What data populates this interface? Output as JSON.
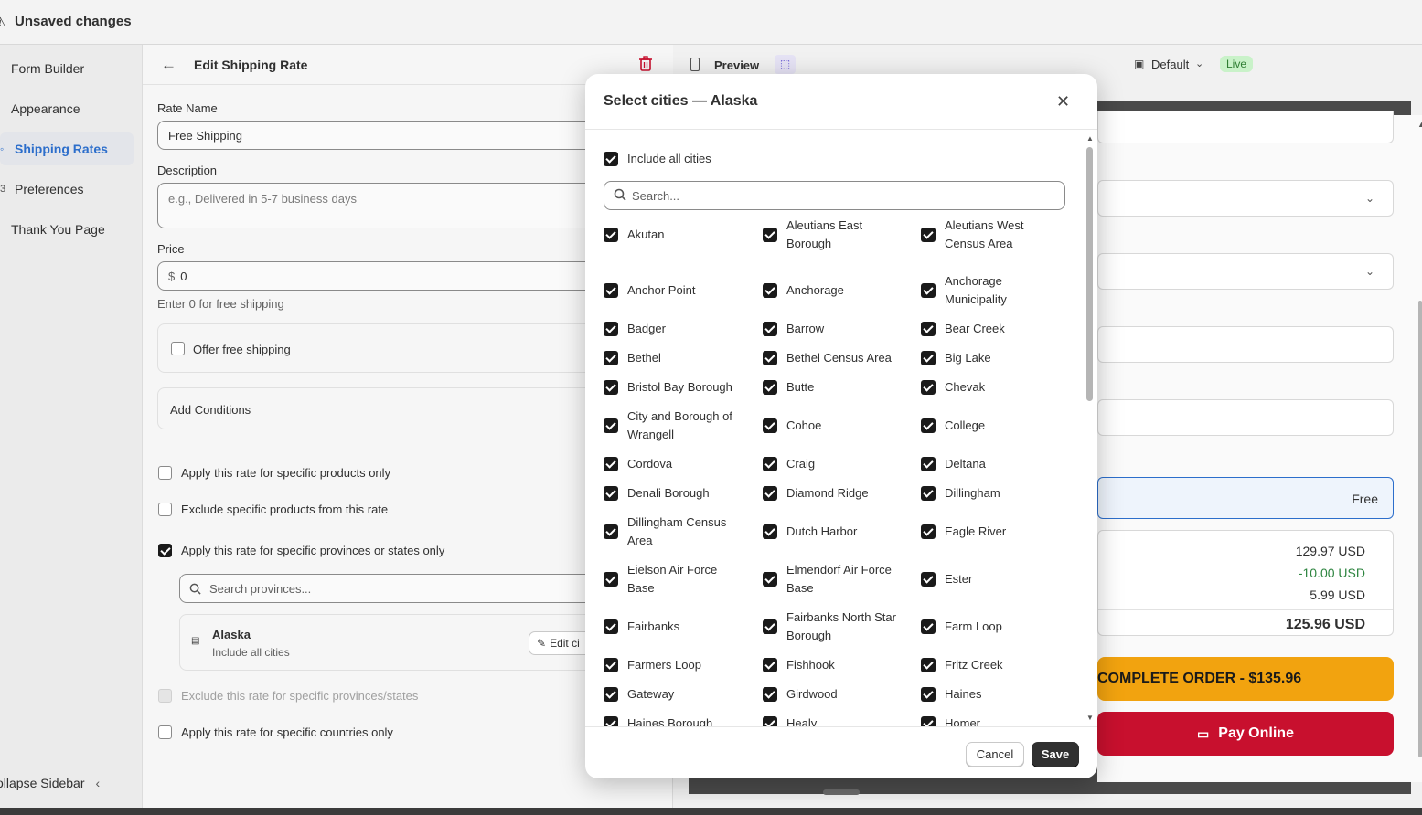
{
  "topbar": {
    "title": "Unsaved changes",
    "warn_icon": "warning-triangle-icon"
  },
  "sidebar": {
    "items": [
      {
        "label": "Form Builder",
        "icon": "form-icon"
      },
      {
        "label": "Appearance",
        "icon": "paint-icon"
      },
      {
        "label": "Shipping Rates",
        "icon": "truck-icon"
      },
      {
        "label": "Preferences",
        "icon": "gear-icon"
      },
      {
        "label": "Thank You Page",
        "icon": "page-icon"
      }
    ],
    "collapse_label": "ollapse Sidebar"
  },
  "editor": {
    "title": "Edit Shipping Rate",
    "rate_name_label": "Rate Name",
    "rate_name_value": "Free Shipping",
    "description_label": "Description",
    "description_placeholder": "e.g., Delivered in 5-7 business days",
    "price_label": "Price",
    "price_prefix": "$",
    "price_value": "0",
    "price_help": "Enter 0 for free shipping",
    "offer_free_label": "Offer free shipping",
    "add_conditions_label": "Add Conditions",
    "opt_products": "Apply this rate for specific products only",
    "opt_exclude_products": "Exclude specific products from this rate",
    "opt_provinces": "Apply this rate for specific provinces or states only",
    "province_search_placeholder": "Search provinces...",
    "province_name": "Alaska",
    "province_sub": "Include all cities",
    "edit_cities_label": "Edit ci",
    "opt_exclude_provinces": "Exclude this rate for specific provinces/states",
    "opt_countries": "Apply this rate for specific countries only"
  },
  "preview": {
    "label": "Preview",
    "theme": "Default",
    "live_badge": "Live",
    "shipping_value": "Free",
    "subtotal": "129.97 USD",
    "discount": "-10.00 USD",
    "shipping": "5.99 USD",
    "total": "125.96 USD",
    "complete_order": "COMPLETE ORDER - $135.96",
    "pay_online": "Pay Online",
    "colors": {
      "order_btn": "#f2a30f",
      "pay_btn": "#c8102e",
      "live": "#c9f2c9",
      "discount": "#2e8540"
    }
  },
  "modal": {
    "title": "Select cities — Alaska",
    "include_all": "Include all cities",
    "search_placeholder": "Search...",
    "cancel": "Cancel",
    "save": "Save",
    "cities": [
      "Akutan",
      "Aleutians East Borough",
      "Aleutians West Census Area",
      "Anchor Point",
      "Anchorage",
      "Anchorage Municipality",
      "Badger",
      "Barrow",
      "Bear Creek",
      "Bethel",
      "Bethel Census Area",
      "Big Lake",
      "Bristol Bay Borough",
      "Butte",
      "Chevak",
      "City and Borough of Wrangell",
      "Cohoe",
      "College",
      "Cordova",
      "Craig",
      "Deltana",
      "Denali Borough",
      "Diamond Ridge",
      "Dillingham",
      "Dillingham Census Area",
      "Dutch Harbor",
      "Eagle River",
      "Eielson Air Force Base",
      "Elmendorf Air Force Base",
      "Ester",
      "Fairbanks",
      "Fairbanks North Star Borough",
      "Farm Loop",
      "Farmers Loop",
      "Fishhook",
      "Fritz Creek",
      "Gateway",
      "Girdwood",
      "Haines",
      "Haines Borough",
      "Healy",
      "Homer"
    ]
  }
}
